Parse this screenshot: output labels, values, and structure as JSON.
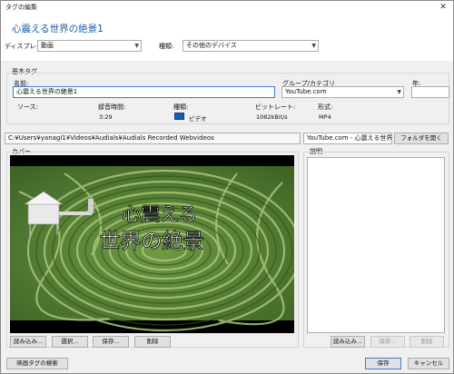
{
  "window": {
    "title": "タグの編集",
    "close_glyph": "✕"
  },
  "header": {
    "heading": "心震える世界の絶景1",
    "display_label": "ディスプレイ:",
    "display_value": "動画",
    "type_label": "種類:",
    "type_value": "その他のデバイス"
  },
  "basic_tags": {
    "group_label": "基本タグ",
    "name_label": "名前:",
    "name_value": "心震える世界の絶景1",
    "genre_label": "グループ/カテゴリ",
    "genre_value": "YouTube.com",
    "year_label": "年:",
    "year_value": "",
    "source_label": "ソース:",
    "duration_label": "録音時間:",
    "duration_value": "3:29",
    "kind_label": "種類:",
    "kind_value": "ビデオ",
    "bitrate_label": "ビットレート:",
    "bitrate_value": "1082kBit/s",
    "format_label": "形式:",
    "format_value": "MP4"
  },
  "path": {
    "folder": "C:¥Users¥yanagi1¥Videos¥Audials¥Audials Recorded Webvideos",
    "filename": "YouTube.com - 心震える世界の絶",
    "open_folder": "フォルダを開く"
  },
  "cover": {
    "label": "カバー",
    "overlay_line1": "心震える",
    "overlay_line2": "世界の絶景",
    "buttons": {
      "load": "読み込み...",
      "select": "選択...",
      "save": "保存...",
      "delete": "削除"
    }
  },
  "description": {
    "label": "説明",
    "value": "",
    "buttons": {
      "load": "読み込み...",
      "save": "保存...",
      "delete": "削除"
    }
  },
  "footer": {
    "search_tags": "映画タグの検索",
    "save": "保存",
    "cancel": "キャンセル"
  },
  "colors": {
    "heading": "#1c5da8",
    "maze_green": "#5f8a3a"
  }
}
